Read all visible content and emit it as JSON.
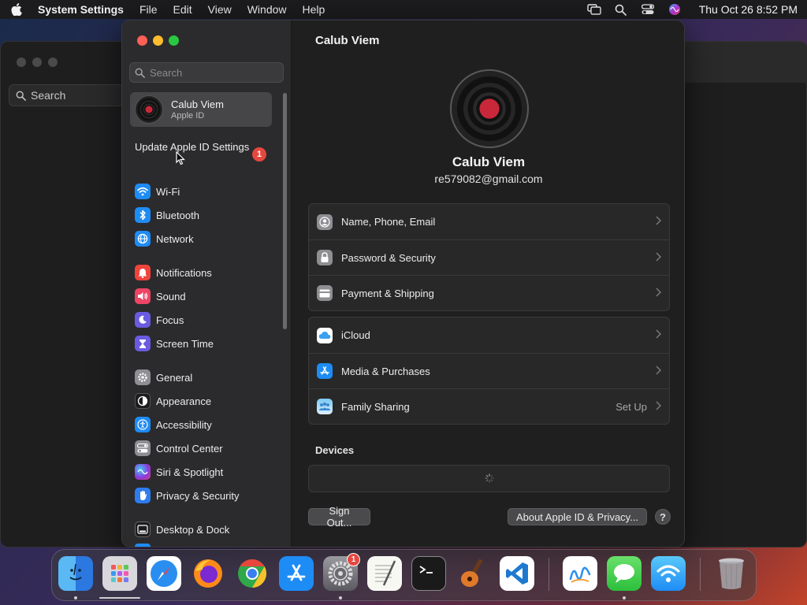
{
  "menubar": {
    "app_name": "System Settings",
    "menus": [
      "File",
      "Edit",
      "View",
      "Window",
      "Help"
    ],
    "clock": "Thu Oct 26  8:52 PM"
  },
  "background_window": {
    "search_placeholder": "Search"
  },
  "sidebar": {
    "search_placeholder": "Search",
    "account": {
      "name": "Calub Viem",
      "subtitle": "Apple ID"
    },
    "update": {
      "label": "Update Apple ID Settings",
      "badge": "1"
    },
    "items": [
      {
        "label": "Wi-Fi",
        "icon": "wifi-icon",
        "color": "#1e8cf5"
      },
      {
        "label": "Bluetooth",
        "icon": "bluetooth-icon",
        "color": "#1e8cf5"
      },
      {
        "label": "Network",
        "icon": "globe-icon",
        "color": "#1e8cf5"
      },
      {
        "label": "Notifications",
        "icon": "bell-icon",
        "color": "#f0443c"
      },
      {
        "label": "Sound",
        "icon": "speaker-icon",
        "color": "#ee4466"
      },
      {
        "label": "Focus",
        "icon": "moon-icon",
        "color": "#6a5be0"
      },
      {
        "label": "Screen Time",
        "icon": "hourglass-icon",
        "color": "#6a5be0"
      },
      {
        "label": "General",
        "icon": "gear-icon",
        "color": "#8e8e93"
      },
      {
        "label": "Appearance",
        "icon": "appearance-icon",
        "color": "#1c1c1e"
      },
      {
        "label": "Accessibility",
        "icon": "accessibility-icon",
        "color": "#1e8cf5"
      },
      {
        "label": "Control Center",
        "icon": "control-center-icon",
        "color": "#8e8e93"
      },
      {
        "label": "Siri & Spotlight",
        "icon": "siri-icon",
        "color": "#c03ac0"
      },
      {
        "label": "Privacy & Security",
        "icon": "hand-icon",
        "color": "#2e7cf0"
      },
      {
        "label": "Desktop & Dock",
        "icon": "dock-icon",
        "color": "#1c1c1e"
      }
    ]
  },
  "content": {
    "title": "Calub Viem",
    "profile": {
      "name": "Calub Viem",
      "email": "re579082@gmail.com"
    },
    "group1": [
      {
        "label": "Name, Phone, Email",
        "icon": "person-icon"
      },
      {
        "label": "Password & Security",
        "icon": "lock-icon"
      },
      {
        "label": "Payment & Shipping",
        "icon": "credit-card-icon"
      }
    ],
    "group2": [
      {
        "label": "iCloud",
        "icon": "cloud-icon",
        "trail": ""
      },
      {
        "label": "Media & Purchases",
        "icon": "app-store-icon",
        "trail": ""
      },
      {
        "label": "Family Sharing",
        "icon": "family-icon",
        "trail": "Set Up"
      }
    ],
    "devices_label": "Devices",
    "sign_out": "Sign Out...",
    "about": "About Apple ID & Privacy...",
    "help": "?"
  },
  "dock": {
    "apps": [
      "Finder",
      "Launchpad",
      "Safari",
      "Firefox",
      "Chrome",
      "App Store",
      "System Settings",
      "TextEdit",
      "Terminal",
      "GarageBand",
      "Visual Studio Code",
      "Freeform",
      "Messages",
      "Wireless Diagnostics",
      "Trash"
    ],
    "system_settings_badge": "1"
  }
}
